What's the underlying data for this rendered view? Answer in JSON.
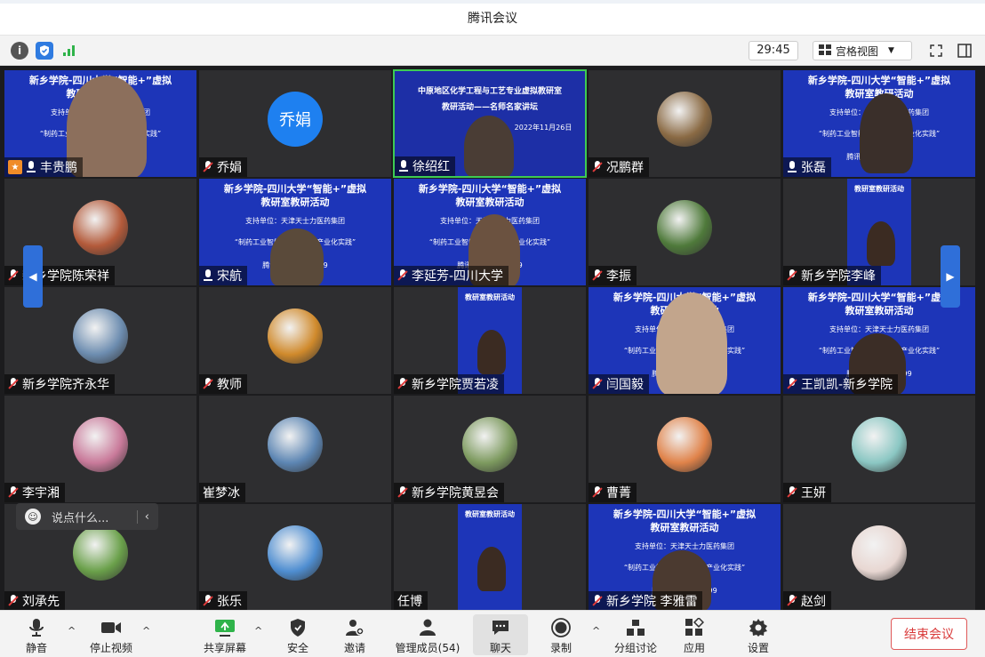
{
  "window": {
    "title": "腾讯会议"
  },
  "toolbar": {
    "info_label": "i",
    "timer": "29:45",
    "view_label": "宫格视图"
  },
  "tiles": [
    {
      "name": "丰贵鹏",
      "kind": "slide-person",
      "host": true,
      "mic": "on"
    },
    {
      "name": "乔娟",
      "kind": "initial-avatar",
      "initial": "乔娟",
      "avatar_color": "#1e80f0",
      "mic": "muted"
    },
    {
      "name": "徐绍红",
      "kind": "slide-person-light",
      "mic": "on"
    },
    {
      "name": "况鹏群",
      "kind": "photo-avatar",
      "avatar_color": "#8a6a44",
      "mic": "muted"
    },
    {
      "name": "张磊",
      "kind": "slide-person",
      "mic": "on"
    },
    {
      "name": "新乡学院陈荣祥",
      "kind": "photo-avatar",
      "avatar_color": "#b35a3a",
      "mic": "muted"
    },
    {
      "name": "宋航",
      "kind": "slide-person",
      "mic": "on"
    },
    {
      "name": "李延芳-四川大学",
      "kind": "slide-person",
      "mic": "muted"
    },
    {
      "name": "李振",
      "kind": "photo-avatar",
      "avatar_color": "#4f7a3b",
      "mic": "muted"
    },
    {
      "name": "新乡学院李峰",
      "kind": "slide-person-narrow",
      "mic": "muted"
    },
    {
      "name": "新乡学院齐永华",
      "kind": "photo-avatar",
      "avatar_color": "#6d8db0",
      "mic": "muted"
    },
    {
      "name": "教师",
      "kind": "photo-avatar",
      "avatar_color": "#d08a2c",
      "mic": "muted"
    },
    {
      "name": "新乡学院贾若凌",
      "kind": "slide-person-narrow",
      "mic": "muted"
    },
    {
      "name": "闫国毅",
      "kind": "slide-person",
      "mic": "muted"
    },
    {
      "name": "王凯凯-新乡学院",
      "kind": "slide-person",
      "mic": "muted"
    },
    {
      "name": "李宇湘",
      "kind": "photo-avatar",
      "avatar_color": "#c97a9a",
      "mic": "muted"
    },
    {
      "name": "崔梦冰",
      "kind": "photo-avatar",
      "avatar_color": "#5d86b3",
      "mic": "none"
    },
    {
      "name": "新乡学院黄昱会",
      "kind": "photo-avatar",
      "avatar_color": "#7d9a5f",
      "mic": "muted"
    },
    {
      "name": "曹菁",
      "kind": "photo-avatar",
      "avatar_color": "#e0834a",
      "mic": "muted"
    },
    {
      "name": "王妍",
      "kind": "photo-avatar",
      "avatar_color": "#8bc7c3",
      "mic": "muted"
    },
    {
      "name": "刘承先",
      "kind": "photo-avatar",
      "avatar_color": "#6aa04a",
      "mic": "muted"
    },
    {
      "name": "张乐",
      "kind": "photo-avatar",
      "avatar_color": "#4f8ed1",
      "mic": "muted"
    },
    {
      "name": "任博",
      "kind": "slide-person-narrow",
      "mic": "none"
    },
    {
      "name": "新乡学院 李雅雷",
      "kind": "slide-person",
      "mic": "muted"
    },
    {
      "name": "赵剑",
      "kind": "photo-avatar",
      "avatar_color": "#e8d7d2",
      "mic": "muted"
    }
  ],
  "slide": {
    "line1": "新乡学院-四川大学“智能+”虚拟",
    "line2": "教研室教研活动",
    "line3": "支持单位：天津天士力医药集团",
    "line4": "“制药工业智能制造发展及产业化实践”",
    "line5": "腾讯会议：633-999"
  },
  "slide_light": {
    "line1": "中原地区化学工程与工艺专业虚拟教研室",
    "line2": "教研活动——名师名家讲坛",
    "line3": "2022年11月26日"
  },
  "chat": {
    "placeholder": "说点什么..."
  },
  "bottom": {
    "mute": "静音",
    "stop_video": "停止视频",
    "share": "共享屏幕",
    "security": "安全",
    "invite": "邀请",
    "members": "管理成员(54)",
    "chat": "聊天",
    "record": "录制",
    "breakout": "分组讨论",
    "apps": "应用",
    "settings": "设置",
    "end": "结束会议"
  },
  "colors": {
    "accent": "#1e80f0",
    "slide_blue": "#1d35b8",
    "end_red": "#d93a3a",
    "active_green": "#3ecb53"
  }
}
